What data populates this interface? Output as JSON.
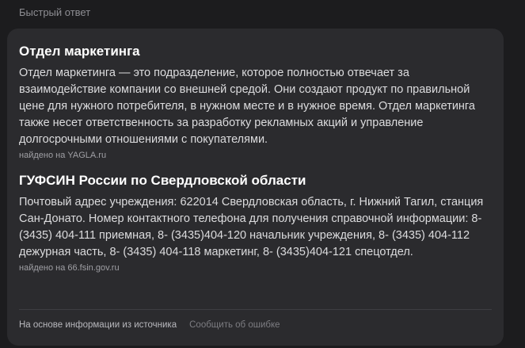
{
  "header": {
    "label": "Быстрый ответ"
  },
  "answers": [
    {
      "title": "Отдел маркетинга",
      "text": "Отдел маркетинга — это подразделение, которое полностью отвечает за взаимодействие компании со внешней средой. Они создают продукт по правильной цене для нужного потребителя, в нужном месте и в нужное время. Отдел маркетинга также несет ответственность за разработку рекламных акций и управление долгосрочными отношениями с покупателями.",
      "source": "найдено на YAGLA.ru"
    },
    {
      "title": "ГУФСИН России по Свердловской области",
      "text": "Почтовый адрес учреждения: 622014 Свердловская область, г. Нижний Тагил, станция Сан-Донато. Номер контактного телефона для получения справочной информации: 8- (3435) 404-111 приемная, 8- (3435)404-120 начальник учреждения, 8- (3435) 404-112 дежурная часть, 8- (3435) 404-118 маркетинг, 8- (3435)404-121 спецотдел.",
      "source": "найдено на 66.fsin.gov.ru"
    }
  ],
  "footer": {
    "based_on": "На основе информации из источника",
    "report": "Сообщить об ошибке"
  }
}
